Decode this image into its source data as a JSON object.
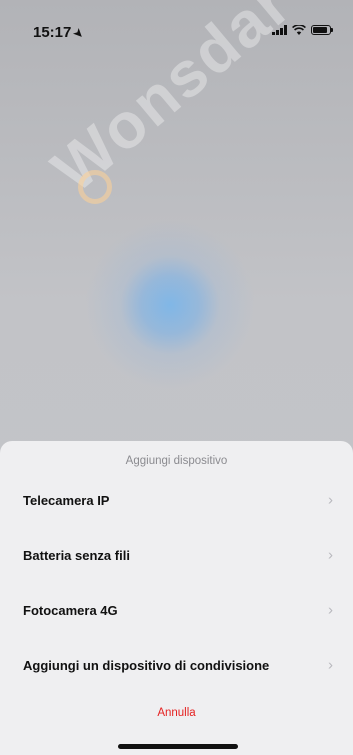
{
  "status_bar": {
    "time": "15:17",
    "location_icon": "location-arrow-icon",
    "signal_icon": "cellular-signal-icon",
    "wifi_icon": "wifi-icon",
    "battery_icon": "battery-icon"
  },
  "watermark": {
    "text": "Wonsdar"
  },
  "sheet": {
    "title": "Aggiungi dispositivo",
    "items": [
      {
        "label": "Telecamera IP",
        "chevron": "›"
      },
      {
        "label": "Batteria senza fili",
        "chevron": "›"
      },
      {
        "label": "Fotocamera 4G",
        "chevron": "›"
      },
      {
        "label": "Aggiungi un dispositivo di condivisione",
        "chevron": "›"
      }
    ],
    "cancel_label": "Annulla"
  },
  "colors": {
    "cancel_text": "#e52222",
    "sheet_background": "#efeff1",
    "radar_blue": "#7db6e8"
  }
}
